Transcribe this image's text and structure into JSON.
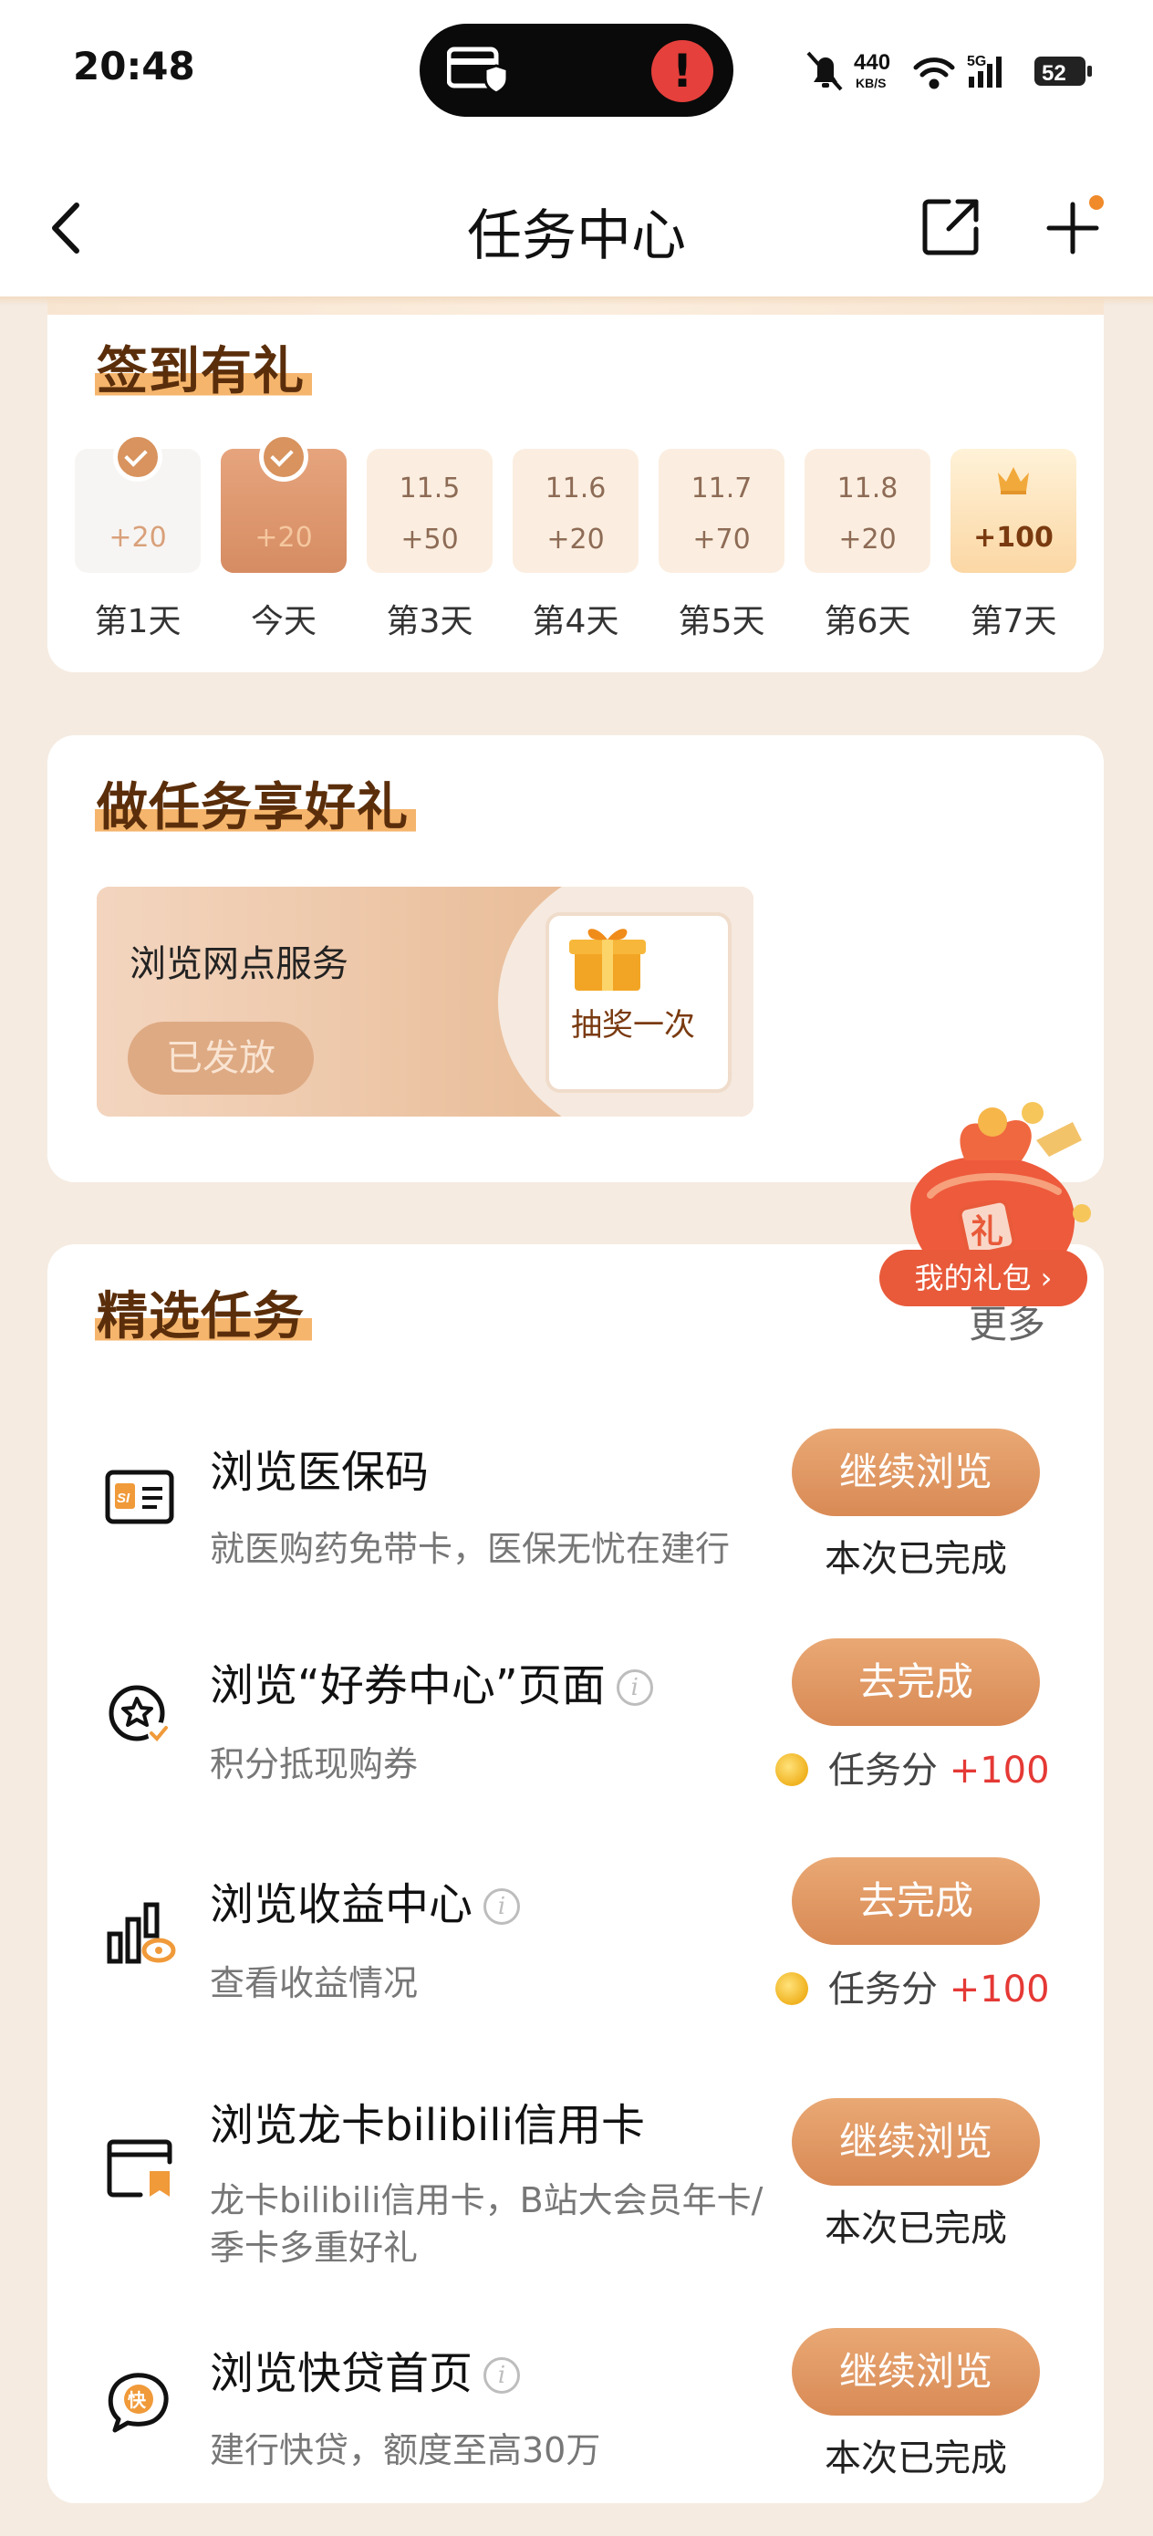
{
  "status_bar": {
    "time": "20:48",
    "net_speed_value": "440",
    "net_speed_unit": "KB/S",
    "network": "5G",
    "battery": "52"
  },
  "nav": {
    "title": "任务中心"
  },
  "checkin": {
    "title": "签到有礼",
    "days": [
      {
        "date": "",
        "points": "+20",
        "label": "第1天",
        "state": "done"
      },
      {
        "date": "",
        "points": "+20",
        "label": "今天",
        "state": "today"
      },
      {
        "date": "11.5",
        "points": "+50",
        "label": "第3天",
        "state": "pending"
      },
      {
        "date": "11.6",
        "points": "+20",
        "label": "第4天",
        "state": "pending"
      },
      {
        "date": "11.7",
        "points": "+70",
        "label": "第5天",
        "state": "pending"
      },
      {
        "date": "11.8",
        "points": "+20",
        "label": "第6天",
        "state": "pending"
      },
      {
        "date": "",
        "points": "+100",
        "label": "第7天",
        "state": "bonus"
      }
    ]
  },
  "gift_section": {
    "title": "做任务享好礼",
    "voucher": {
      "name": "浏览网点服务",
      "status": "已发放",
      "prize": "抽奖一次"
    }
  },
  "tasks_section": {
    "title": "精选任务",
    "more": "更多",
    "items": [
      {
        "icon": "social-security-card-icon",
        "title": "浏览医保码",
        "desc": "就医购药免带卡，医保无忧在建行",
        "button": "继续浏览",
        "status": "本次已完成"
      },
      {
        "icon": "coupon-star-icon",
        "title": "浏览“好券中心”页面",
        "desc": "积分抵现购券",
        "button": "去完成",
        "points_label": "任务分",
        "points_value": "+100"
      },
      {
        "icon": "earnings-chart-icon",
        "title": "浏览收益中心",
        "desc": "查看收益情况",
        "button": "去完成",
        "points_label": "任务分",
        "points_value": "+100"
      },
      {
        "icon": "credit-card-icon",
        "title": "浏览龙卡bilibili信用卡",
        "desc": "龙卡bilibili信用卡，B站大会员年卡/季卡多重好礼",
        "button": "继续浏览",
        "status": "本次已完成"
      },
      {
        "icon": "quick-loan-icon",
        "title": "浏览快贷首页",
        "desc": "建行快贷，额度至高30万",
        "button": "继续浏览",
        "status": "本次已完成"
      }
    ]
  },
  "floating_gift": {
    "label": "我的礼包 ›"
  },
  "colors": {
    "accent": "#d98a55",
    "title_brown": "#5b2e0b",
    "points_red": "#e53935",
    "page_bg": "#f5ebe1"
  }
}
